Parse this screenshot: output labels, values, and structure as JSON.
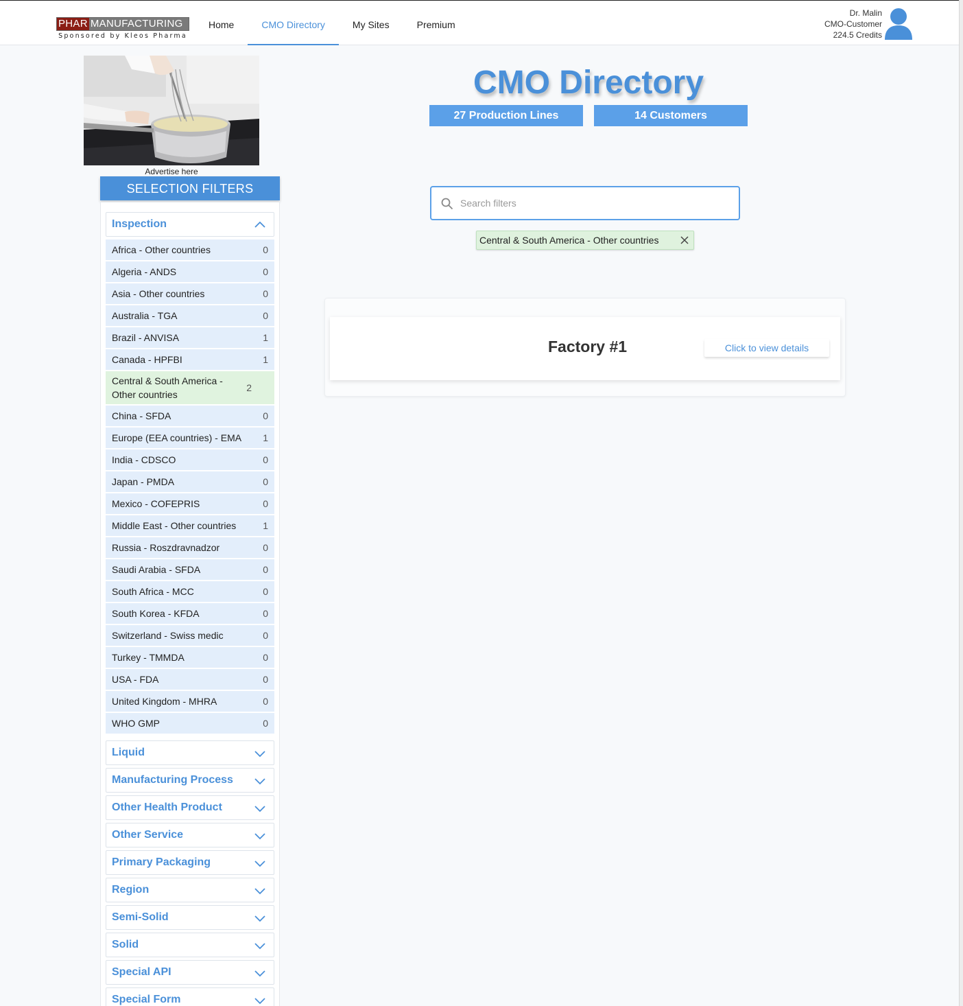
{
  "header": {
    "logo_part1": "PHAR",
    "logo_part2": "MANUFACTURING",
    "logo_sponsor": "Sponsored by Kleos Pharma",
    "nav": [
      "Home",
      "CMO Directory",
      "My Sites",
      "Premium"
    ],
    "active_nav": "CMO Directory",
    "user_name": "Dr. Malin",
    "user_role": "CMO-Customer",
    "user_credits": "224.5 Credits"
  },
  "sidebar": {
    "ad_label": "Advertise here",
    "filters_title": "SELECTION FILTERS",
    "open_section": "Inspection",
    "items": [
      {
        "label": "Africa - Other countries",
        "count": "0"
      },
      {
        "label": "Algeria - ANDS",
        "count": "0"
      },
      {
        "label": "Asia - Other countries",
        "count": "0"
      },
      {
        "label": "Australia - TGA",
        "count": "0"
      },
      {
        "label": "Brazil - ANVISA",
        "count": "1"
      },
      {
        "label": "Canada - HPFBI",
        "count": "1"
      },
      {
        "label": "Central & South America - Other countries",
        "count": "2",
        "selected": true
      },
      {
        "label": "China - SFDA",
        "count": "0"
      },
      {
        "label": "Europe (EEA countries) - EMA",
        "count": "1"
      },
      {
        "label": "India - CDSCO",
        "count": "0"
      },
      {
        "label": "Japan - PMDA",
        "count": "0"
      },
      {
        "label": "Mexico - COFEPRIS",
        "count": "0"
      },
      {
        "label": "Middle East - Other countries",
        "count": "1"
      },
      {
        "label": "Russia - Roszdravnadzor",
        "count": "0"
      },
      {
        "label": "Saudi Arabia - SFDA",
        "count": "0"
      },
      {
        "label": "South Africa - MCC",
        "count": "0"
      },
      {
        "label": "South Korea - KFDA",
        "count": "0"
      },
      {
        "label": "Switzerland - Swiss medic",
        "count": "0"
      },
      {
        "label": "Turkey - TMMDA",
        "count": "0"
      },
      {
        "label": "USA - FDA",
        "count": "0"
      },
      {
        "label": "United Kingdom - MHRA",
        "count": "0"
      },
      {
        "label": "WHO GMP",
        "count": "0"
      }
    ],
    "collapsed_sections": [
      "Liquid",
      "Manufacturing Process",
      "Other Health Product",
      "Other Service",
      "Primary Packaging",
      "Region",
      "Semi-Solid",
      "Solid",
      "Special API",
      "Special Form"
    ]
  },
  "main": {
    "title": "CMO Directory",
    "stat_lines": "27 Production Lines",
    "stat_customers": "14 Customers",
    "search_placeholder": "Search filters",
    "search_value": "",
    "active_filter": "Central & South America - Other countries",
    "results": [
      {
        "name": "Factory #1",
        "action": "Click to view details"
      }
    ]
  },
  "colors": {
    "accent": "#4a90d9",
    "selected": "#e0f3df",
    "item_bg": "#e3eefb",
    "logo_red": "#8b1d14"
  }
}
